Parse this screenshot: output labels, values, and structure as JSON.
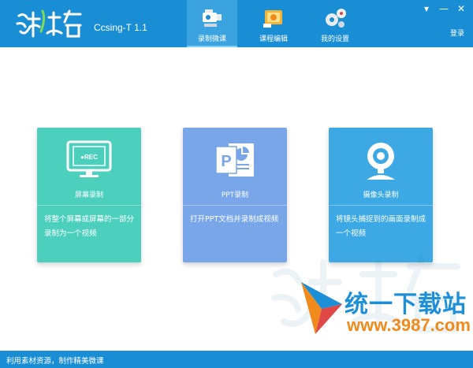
{
  "header": {
    "app_title": "Ccsing-T 1.1",
    "login": "登录",
    "tabs": [
      {
        "label": "录制微课",
        "active": true,
        "icon": "camcorder-icon"
      },
      {
        "label": "课程编辑",
        "active": false,
        "icon": "video-edit-icon"
      },
      {
        "label": "我的设置",
        "active": false,
        "icon": "gears-icon"
      }
    ],
    "window_controls": {
      "menu": "▾",
      "minimize": "—",
      "close": "✕"
    },
    "color": "#1a8ed4"
  },
  "cards": [
    {
      "title": "屏幕录制",
      "desc_line1": "将整个屏幕或屏幕的一部分",
      "desc_line2": "录制为一个视频",
      "icon_text": "●REC",
      "color": "#4ccfbd",
      "icon": "screen-record-icon"
    },
    {
      "title": "PPT录制",
      "desc_line1": "打开PPT文档并录制成视频",
      "desc_line2": "",
      "icon_text": "P",
      "color": "#78a6e8",
      "icon": "powerpoint-icon"
    },
    {
      "title": "摄像头录制",
      "desc_line1": "将镜头捕捉到的画面录制成",
      "desc_line2": "一个视频",
      "color": "#3da9e4",
      "icon": "webcam-icon"
    }
  ],
  "watermark": {
    "main": "统一下载站",
    "url": "www.3987.com"
  },
  "footer": {
    "text": "利用素材资源，制作精美微课"
  }
}
